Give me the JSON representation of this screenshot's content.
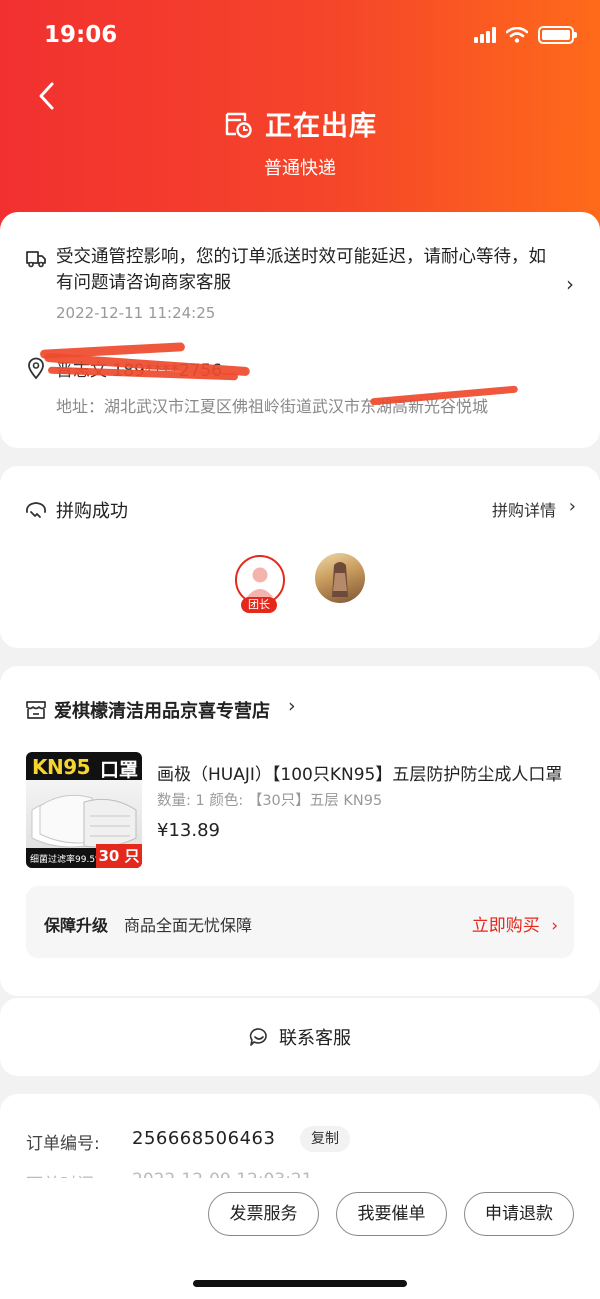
{
  "status_bar": {
    "time": "19:06"
  },
  "header": {
    "title": "正在出库",
    "subtitle": "普通快递",
    "icons": [
      "back-chevron-icon",
      "package-clock-icon"
    ]
  },
  "logistics": {
    "notice": "受交通管控影响，您的订单派送时效可能延迟，请耐心等待，如有问题请咨询商家客服",
    "time": "2022-12-11 11:24:25",
    "recipient": "晋志文  189****2756",
    "address": "地址：湖北武汉市江夏区佛祖岭街道武汉市东湖高新光谷悦城"
  },
  "group_buy": {
    "title": "拼购成功",
    "detail_label": "拼购详情",
    "leader_badge": "团长"
  },
  "shop": {
    "name": "爱棋檬清洁用品京喜专营店"
  },
  "product": {
    "image_text": {
      "brand": "KN95",
      "kind": "口罩",
      "filter": "细菌过滤率99.5%",
      "count": "30 只"
    },
    "title": "画极（HUAJI）【100只KN95】五层防护防尘成人口罩",
    "spec": "数量: 1  颜色: 【30只】五层 KN95",
    "price": "¥13.89"
  },
  "guarantee": {
    "title": "保障升级",
    "desc": "商品全面无忧保障",
    "action": "立即购买"
  },
  "contact": {
    "label": "联系客服"
  },
  "order": {
    "number_label": "订单编号:",
    "number": "256668506463",
    "copy_label": "复制",
    "time_label": "下单时间:",
    "time": "2022-12-09 12:03:21"
  },
  "bottom_actions": {
    "invoice": "发票服务",
    "urge": "我要催单",
    "refund": "申请退款"
  },
  "colors": {
    "brand_red": "#e5281c",
    "header_gradient_start": "#f23030",
    "header_gradient_end": "#ff6a1a"
  }
}
